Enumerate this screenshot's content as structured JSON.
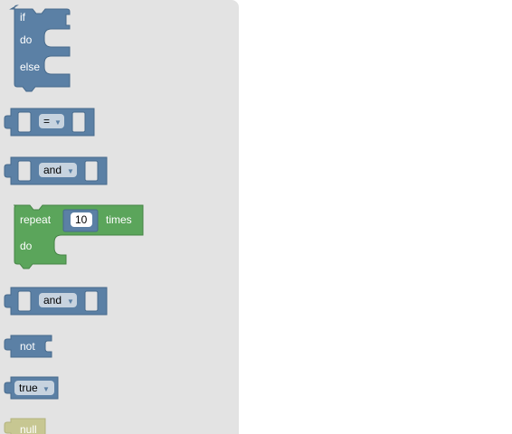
{
  "colors": {
    "logic": "#5b80a5",
    "logic_dark": "#476a8c",
    "loops": "#5ba55b",
    "loops_dark": "#468446",
    "null": "#c7c792",
    "flyout_bg": "#e3e3e3",
    "workspace_bg": "#ffffff"
  },
  "blocks": {
    "if_else": {
      "if_label": "if",
      "do_label": "do",
      "else_label": "else"
    },
    "compare": {
      "op": "="
    },
    "operation_1": {
      "op": "and"
    },
    "repeat": {
      "repeat_label": "repeat",
      "times_value": "10",
      "times_label": "times",
      "do_label": "do"
    },
    "operation_2": {
      "op": "and"
    },
    "negate": {
      "label": "not"
    },
    "boolean": {
      "value": "true"
    },
    "null": {
      "label": "null"
    }
  }
}
